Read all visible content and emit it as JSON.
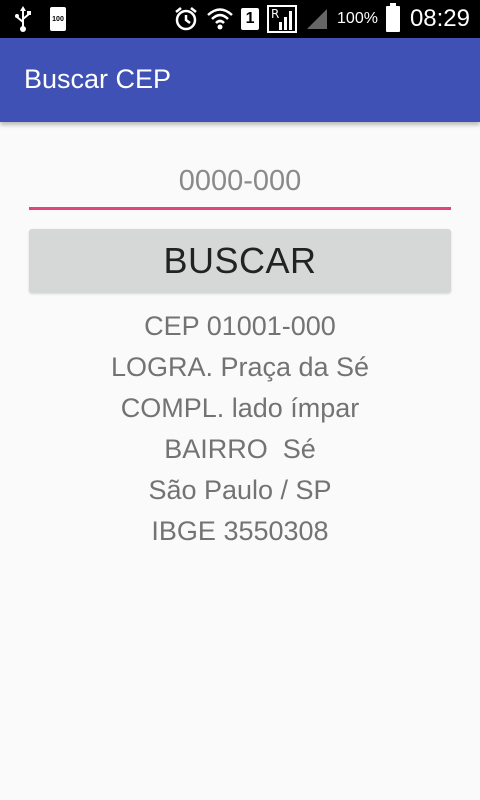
{
  "status_bar": {
    "battery_small_label": "100",
    "sim_slot": "1",
    "battery_percent": "100%",
    "time": "08:29",
    "icons": [
      "usb-icon",
      "battery-icon",
      "alarm-icon",
      "wifi-icon",
      "sim-icon",
      "roaming-signal-icon",
      "signal-icon",
      "battery-icon"
    ]
  },
  "app_bar": {
    "title": "Buscar CEP",
    "color": "#3f51b5"
  },
  "form": {
    "cep_placeholder": "0000-000",
    "cep_value": "",
    "underline_color": "#e2457e",
    "search_label": "BUSCAR"
  },
  "result": {
    "cep": "CEP 01001-000",
    "logradouro": "LOGRA. Praça da Sé",
    "complemento": "COMPL. lado ímpar",
    "bairro": "BAIRRO  Sé",
    "cidade_uf": "São Paulo / SP",
    "ibge": "IBGE 3550308"
  }
}
